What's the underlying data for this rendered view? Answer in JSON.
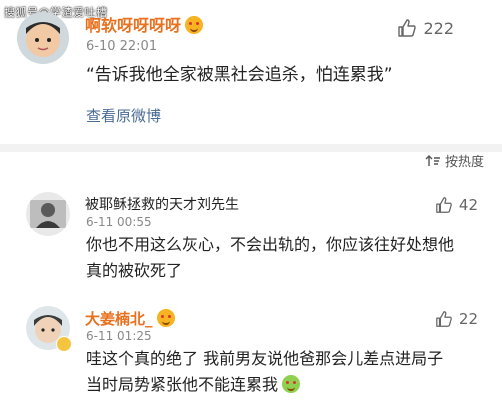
{
  "watermark": "搜狐号@学渣爱吐槽",
  "post": {
    "username": "啊软呀呀呀呀",
    "time": "6-10 22:01",
    "text": "“告诉我他全家被黑社会追杀，怕连累我”",
    "view_original": "查看原微博",
    "likes": "222",
    "emoji_icon": "grin-emoji-icon"
  },
  "sort": {
    "label": "按热度"
  },
  "comments": [
    {
      "username": "被耶稣拯救的天才刘先生",
      "time": "6-11 00:55",
      "likes": "42",
      "lines": [
        "你也不用这么灰心，不会出轨的，你应该往好处想他",
        "真的被砍死了"
      ]
    },
    {
      "username": "大姜楠北_",
      "time": "6-11 01:25",
      "likes": "22",
      "lines": [
        "哇这个真的绝了 我前男友说他爸那会儿差点进局子",
        "当时局势紧张他不能连累我"
      ]
    }
  ],
  "colors": {
    "username_accent": "#e8711f",
    "link": "#4a6b94",
    "divider": "#f2f2f2"
  }
}
